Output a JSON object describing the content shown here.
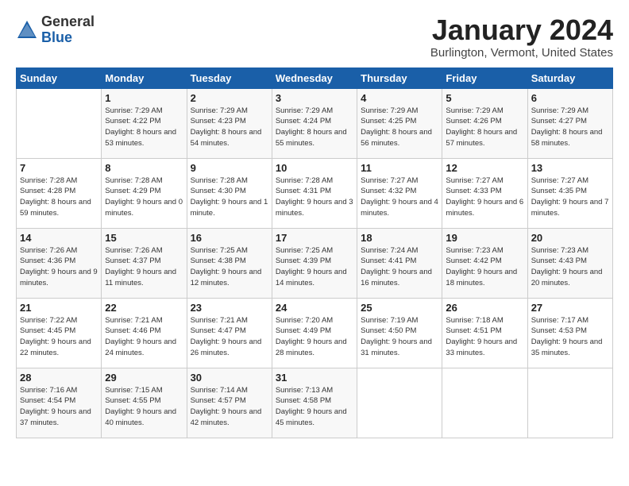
{
  "header": {
    "logo_general": "General",
    "logo_blue": "Blue",
    "month": "January 2024",
    "location": "Burlington, Vermont, United States"
  },
  "weekdays": [
    "Sunday",
    "Monday",
    "Tuesday",
    "Wednesday",
    "Thursday",
    "Friday",
    "Saturday"
  ],
  "weeks": [
    [
      {
        "num": "",
        "empty": true
      },
      {
        "num": "1",
        "sunrise": "7:29 AM",
        "sunset": "4:22 PM",
        "daylight": "8 hours and 53 minutes."
      },
      {
        "num": "2",
        "sunrise": "7:29 AM",
        "sunset": "4:23 PM",
        "daylight": "8 hours and 54 minutes."
      },
      {
        "num": "3",
        "sunrise": "7:29 AM",
        "sunset": "4:24 PM",
        "daylight": "8 hours and 55 minutes."
      },
      {
        "num": "4",
        "sunrise": "7:29 AM",
        "sunset": "4:25 PM",
        "daylight": "8 hours and 56 minutes."
      },
      {
        "num": "5",
        "sunrise": "7:29 AM",
        "sunset": "4:26 PM",
        "daylight": "8 hours and 57 minutes."
      },
      {
        "num": "6",
        "sunrise": "7:29 AM",
        "sunset": "4:27 PM",
        "daylight": "8 hours and 58 minutes."
      }
    ],
    [
      {
        "num": "7",
        "sunrise": "7:28 AM",
        "sunset": "4:28 PM",
        "daylight": "8 hours and 59 minutes."
      },
      {
        "num": "8",
        "sunrise": "7:28 AM",
        "sunset": "4:29 PM",
        "daylight": "9 hours and 0 minutes."
      },
      {
        "num": "9",
        "sunrise": "7:28 AM",
        "sunset": "4:30 PM",
        "daylight": "9 hours and 1 minute."
      },
      {
        "num": "10",
        "sunrise": "7:28 AM",
        "sunset": "4:31 PM",
        "daylight": "9 hours and 3 minutes."
      },
      {
        "num": "11",
        "sunrise": "7:27 AM",
        "sunset": "4:32 PM",
        "daylight": "9 hours and 4 minutes."
      },
      {
        "num": "12",
        "sunrise": "7:27 AM",
        "sunset": "4:33 PM",
        "daylight": "9 hours and 6 minutes."
      },
      {
        "num": "13",
        "sunrise": "7:27 AM",
        "sunset": "4:35 PM",
        "daylight": "9 hours and 7 minutes."
      }
    ],
    [
      {
        "num": "14",
        "sunrise": "7:26 AM",
        "sunset": "4:36 PM",
        "daylight": "9 hours and 9 minutes."
      },
      {
        "num": "15",
        "sunrise": "7:26 AM",
        "sunset": "4:37 PM",
        "daylight": "9 hours and 11 minutes."
      },
      {
        "num": "16",
        "sunrise": "7:25 AM",
        "sunset": "4:38 PM",
        "daylight": "9 hours and 12 minutes."
      },
      {
        "num": "17",
        "sunrise": "7:25 AM",
        "sunset": "4:39 PM",
        "daylight": "9 hours and 14 minutes."
      },
      {
        "num": "18",
        "sunrise": "7:24 AM",
        "sunset": "4:41 PM",
        "daylight": "9 hours and 16 minutes."
      },
      {
        "num": "19",
        "sunrise": "7:23 AM",
        "sunset": "4:42 PM",
        "daylight": "9 hours and 18 minutes."
      },
      {
        "num": "20",
        "sunrise": "7:23 AM",
        "sunset": "4:43 PM",
        "daylight": "9 hours and 20 minutes."
      }
    ],
    [
      {
        "num": "21",
        "sunrise": "7:22 AM",
        "sunset": "4:45 PM",
        "daylight": "9 hours and 22 minutes."
      },
      {
        "num": "22",
        "sunrise": "7:21 AM",
        "sunset": "4:46 PM",
        "daylight": "9 hours and 24 minutes."
      },
      {
        "num": "23",
        "sunrise": "7:21 AM",
        "sunset": "4:47 PM",
        "daylight": "9 hours and 26 minutes."
      },
      {
        "num": "24",
        "sunrise": "7:20 AM",
        "sunset": "4:49 PM",
        "daylight": "9 hours and 28 minutes."
      },
      {
        "num": "25",
        "sunrise": "7:19 AM",
        "sunset": "4:50 PM",
        "daylight": "9 hours and 31 minutes."
      },
      {
        "num": "26",
        "sunrise": "7:18 AM",
        "sunset": "4:51 PM",
        "daylight": "9 hours and 33 minutes."
      },
      {
        "num": "27",
        "sunrise": "7:17 AM",
        "sunset": "4:53 PM",
        "daylight": "9 hours and 35 minutes."
      }
    ],
    [
      {
        "num": "28",
        "sunrise": "7:16 AM",
        "sunset": "4:54 PM",
        "daylight": "9 hours and 37 minutes."
      },
      {
        "num": "29",
        "sunrise": "7:15 AM",
        "sunset": "4:55 PM",
        "daylight": "9 hours and 40 minutes."
      },
      {
        "num": "30",
        "sunrise": "7:14 AM",
        "sunset": "4:57 PM",
        "daylight": "9 hours and 42 minutes."
      },
      {
        "num": "31",
        "sunrise": "7:13 AM",
        "sunset": "4:58 PM",
        "daylight": "9 hours and 45 minutes."
      },
      {
        "num": "",
        "empty": true
      },
      {
        "num": "",
        "empty": true
      },
      {
        "num": "",
        "empty": true
      }
    ]
  ],
  "labels": {
    "sunrise": "Sunrise:",
    "sunset": "Sunset:",
    "daylight": "Daylight:"
  }
}
